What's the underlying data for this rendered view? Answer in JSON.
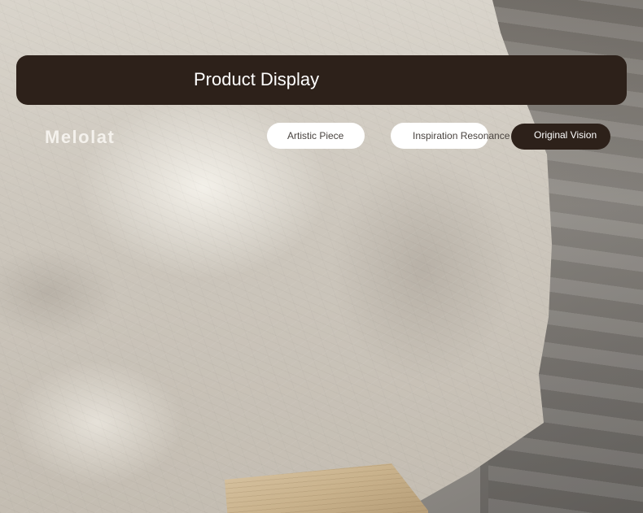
{
  "header": {
    "title": "Product Display"
  },
  "brand": {
    "name": "Melolat"
  },
  "nav": {
    "items": [
      {
        "label": "Artistic Piece",
        "style": "light"
      },
      {
        "label": "Inspiration Resonance",
        "style": "light"
      },
      {
        "label": "Original Vision",
        "style": "dark",
        "selected": true
      }
    ]
  },
  "colors": {
    "bar": "#2d211a",
    "pill_light": "#ffffff",
    "pill_dark": "#2d211a",
    "brand_text": "#f4f1ec"
  }
}
